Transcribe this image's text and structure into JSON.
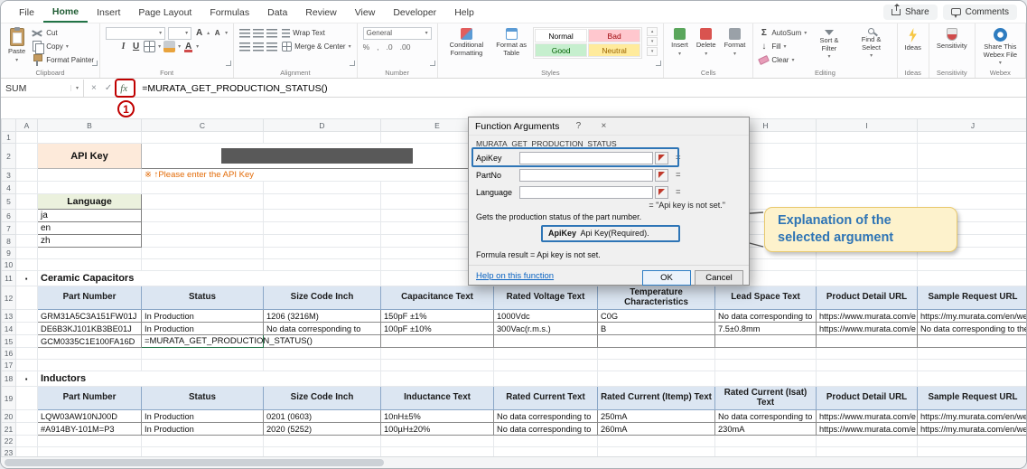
{
  "ribbon": {
    "tabs": [
      "File",
      "Home",
      "Insert",
      "Page Layout",
      "Formulas",
      "Data",
      "Review",
      "View",
      "Developer",
      "Help"
    ],
    "share": "Share",
    "comments": "Comments",
    "clipboard": {
      "caption": "Clipboard",
      "paste": "Paste",
      "cut": "Cut",
      "copy": "Copy",
      "format_painter": "Format Painter"
    },
    "font": {
      "caption": "Font",
      "bold": "B",
      "italic": "I",
      "underline": "U"
    },
    "alignment": {
      "caption": "Alignment",
      "wrap_text": "Wrap Text",
      "merge_center": "Merge & Center"
    },
    "number": {
      "caption": "Number",
      "format": "General"
    },
    "styles": {
      "caption": "Styles",
      "conditional": "Conditional Formatting",
      "format_table": "Format as Table",
      "gallery": [
        "Normal",
        "Bad",
        "Good",
        "Neutral"
      ]
    },
    "cells": {
      "caption": "Cells",
      "insert": "Insert",
      "delete": "Delete",
      "format": "Format"
    },
    "editing": {
      "caption": "Editing",
      "autosum": "AutoSum",
      "fill": "Fill",
      "clear": "Clear",
      "sort_filter": "Sort & Filter",
      "find_select": "Find & Select"
    },
    "ideas": {
      "caption": "Ideas",
      "button": "Ideas"
    },
    "sensitivity": {
      "caption": "Sensitivity",
      "button": "Sensitivity"
    },
    "webex": {
      "caption": "Webex",
      "button": "Share This Webex File"
    }
  },
  "formula_bar": {
    "name_box": "SUM",
    "formula": "=MURATA_GET_PRODUCTION_STATUS()"
  },
  "icons": {
    "caret": "▾",
    "caret_up": "▴",
    "close": "×",
    "check": "✓",
    "fx": "fx",
    "help": "?",
    "sigma": "Σ",
    "fill_arrow": "↓",
    "percent": "%",
    "comma": ",",
    "dec_inc": ".0",
    "dec_dec": ".00",
    "letter_a": "A"
  },
  "sheet": {
    "col_letters": [
      "A",
      "B",
      "C",
      "D",
      "E",
      "F",
      "G",
      "H",
      "I",
      "J"
    ],
    "row_numbers": [
      "1",
      "2",
      "3",
      "4",
      "5",
      "6",
      "7",
      "8",
      "9",
      "10",
      "11",
      "12",
      "13",
      "14",
      "15",
      "16",
      "17",
      "18",
      "19",
      "20",
      "21",
      "22",
      "23"
    ],
    "bullet": "·",
    "api_key": {
      "label": "API Key",
      "note": "※ ↑Please enter the API Key"
    },
    "language": {
      "label": "Language",
      "options": [
        "ja",
        "en",
        "zh"
      ]
    }
  },
  "capacitors": {
    "title": "Ceramic Capacitors",
    "headers": [
      "Part Number",
      "Status",
      "Size Code Inch",
      "Capacitance Text",
      "Rated Voltage Text",
      "Temperature Characteristics",
      "Lead Space Text",
      "Product Detail URL",
      "Sample Request URL"
    ],
    "rows": [
      [
        "GRM31A5C3A151FW01J",
        "In Production",
        "1206 (3216M)",
        "150pF ±1%",
        "1000Vdc",
        "C0G",
        "No data corresponding to",
        "https://www.murata.com/e",
        "https://my.murata.com/en/web/s"
      ],
      [
        "DE6B3KJ101KB3BE01J",
        "In Production",
        "No data corresponding to",
        "100pF ±10%",
        "300Vac(r.m.s.)",
        "B",
        "7.5±0.8mm",
        "https://www.murata.com/e",
        "No data corresponding to the req"
      ],
      [
        "GCM0335C1E100FA16D",
        "=MURATA_GET_PRODUCTION_STATUS()",
        "",
        "",
        "",
        "",
        "",
        "",
        ""
      ]
    ]
  },
  "inductors": {
    "title": "Inductors",
    "headers": [
      "Part Number",
      "Status",
      "Size Code Inch",
      "Inductance Text",
      "Rated Current Text",
      "Rated Current (Itemp) Text",
      "Rated Current (Isat) Text",
      "Product Detail URL",
      "Sample Request URL"
    ],
    "rows": [
      [
        "LQW03AW10NJ00D",
        "In Production",
        "0201 (0603)",
        "10nH±5%",
        "No data corresponding to",
        "250mA",
        "No data corresponding to",
        "https://www.murata.com/e",
        "https://my.murata.com/en/web/s"
      ],
      [
        "#A914BY-101M=P3",
        "In Production",
        "2020 (5252)",
        "100µH±20%",
        "No data corresponding to",
        "260mA",
        "230mA",
        "https://www.murata.com/e",
        "https://my.murata.com/en/web/s"
      ]
    ]
  },
  "dialog": {
    "title": "Function Arguments",
    "function_name": "MURATA_GET_PRODUCTION_STATUS",
    "field_labels": [
      "ApiKey",
      "PartNo",
      "Language"
    ],
    "eq_sign": "=",
    "result_preview": "=  \"Api key is not set.\"",
    "description": "Gets the production status of the part number.",
    "arg_name": "ApiKey",
    "arg_help": "Api Key(Required).",
    "formula_result": "Formula result =  Api key is not set.",
    "help_link": "Help on this function",
    "ok": "OK",
    "cancel": "Cancel"
  },
  "annotations": {
    "step": "1",
    "callout_line1": "Explanation of the",
    "callout_line2": "selected argument"
  }
}
